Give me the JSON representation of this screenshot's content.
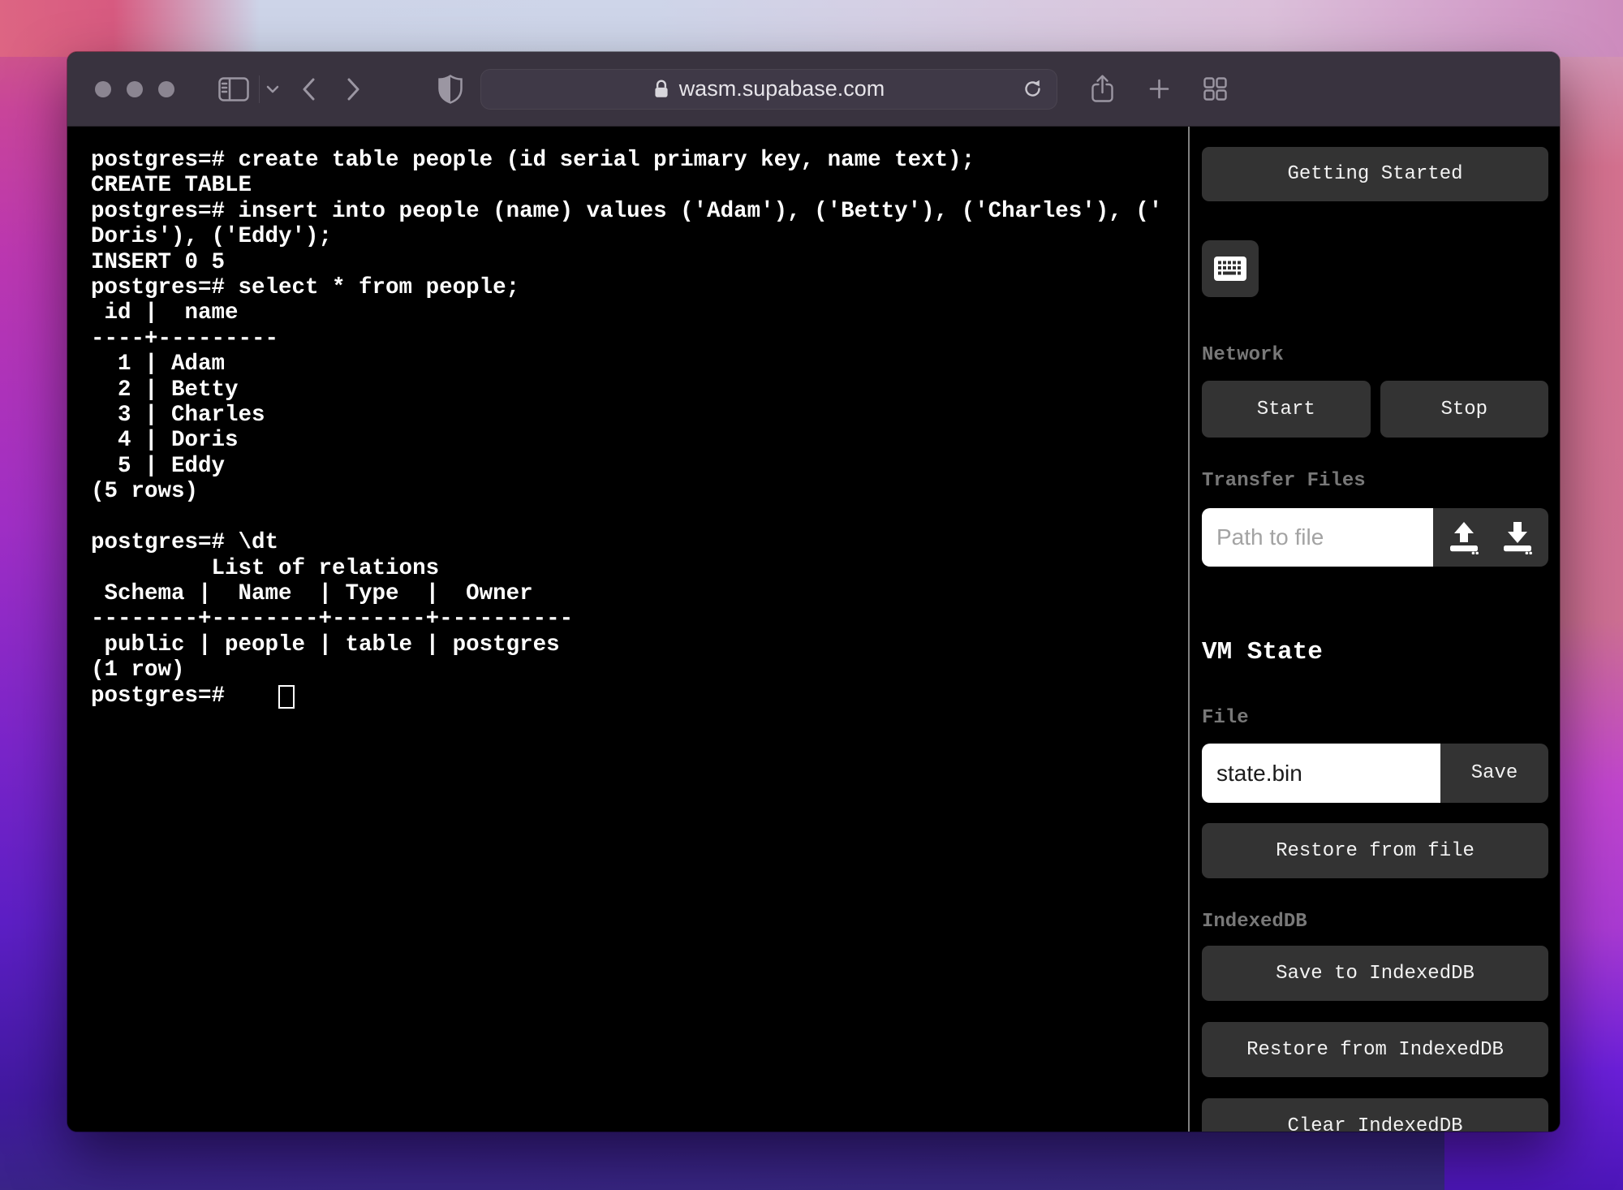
{
  "browser": {
    "url": "wasm.supabase.com"
  },
  "terminal": {
    "output": "postgres=# create table people (id serial primary key, name text);\nCREATE TABLE\npostgres=# insert into people (name) values ('Adam'), ('Betty'), ('Charles'), ('\nDoris'), ('Eddy');\nINSERT 0 5\npostgres=# select * from people;\n id |  name   \n----+---------\n  1 | Adam\n  2 | Betty\n  3 | Charles\n  4 | Doris\n  5 | Eddy\n(5 rows)\n\npostgres=# \\dt\n         List of relations\n Schema |  Name  | Type  |  Owner  \n--------+--------+-------+----------\n public | people | table | postgres\n(1 row)\n",
    "prompt_line": "postgres=#    "
  },
  "sidebar": {
    "getting_started_label": "Getting Started",
    "network": {
      "label": "Network",
      "start_label": "Start",
      "stop_label": "Stop"
    },
    "transfer_files": {
      "label": "Transfer Files",
      "path_placeholder": "Path to file"
    },
    "vm_state": {
      "heading": "VM State",
      "file_label": "File",
      "file_value": "state.bin",
      "save_label": "Save",
      "restore_file_label": "Restore from file",
      "indexeddb_label": "IndexedDB",
      "save_idb_label": "Save to IndexedDB",
      "restore_idb_label": "Restore from IndexedDB",
      "clear_idb_label": "Clear IndexedDB"
    }
  },
  "colors": {
    "accent_button": "#333333",
    "terminal_bg": "#000000",
    "titlebar_bg": "#39333f",
    "label_gray": "#787878"
  }
}
